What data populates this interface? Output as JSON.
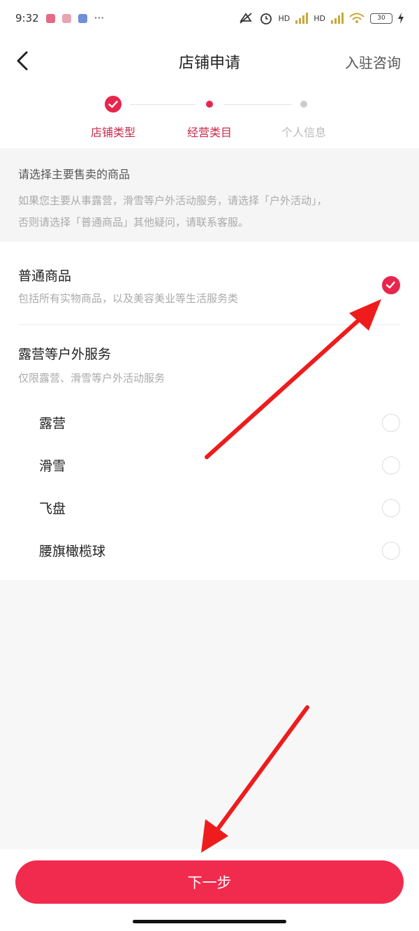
{
  "status_bar": {
    "time": "9:32",
    "more": "···",
    "hd1": "HD",
    "hd2": "HD",
    "battery": "30"
  },
  "nav": {
    "title": "店铺申请",
    "right_link": "入驻咨询"
  },
  "steps": [
    {
      "label": "店铺类型",
      "state": "done"
    },
    {
      "label": "经营类目",
      "state": "current"
    },
    {
      "label": "个人信息",
      "state": "pending"
    }
  ],
  "notice": {
    "title": "请选择主要售卖的商品",
    "line1": "如果您主要从事露营，滑雪等户外活动服务，请选择「户外活动」，",
    "line2": "否则请选择「普通商品」其他疑问，请联系客服。"
  },
  "options": {
    "general": {
      "title": "普通商品",
      "subtitle": "包括所有实物商品，以及美容美业等生活服务类",
      "selected": true
    },
    "outdoor": {
      "title": "露营等户外服务",
      "subtitle": "仅限露营、滑雪等户外活动服务",
      "items": [
        {
          "label": "露营",
          "selected": false
        },
        {
          "label": "滑雪",
          "selected": false
        },
        {
          "label": "飞盘",
          "selected": false
        },
        {
          "label": "腰旗橄榄球",
          "selected": false
        }
      ]
    }
  },
  "footer": {
    "next_label": "下一步"
  },
  "colors": {
    "accent": "#e8264d",
    "button": "#f12b4e",
    "annotation_arrow": "#ee1c1c"
  }
}
